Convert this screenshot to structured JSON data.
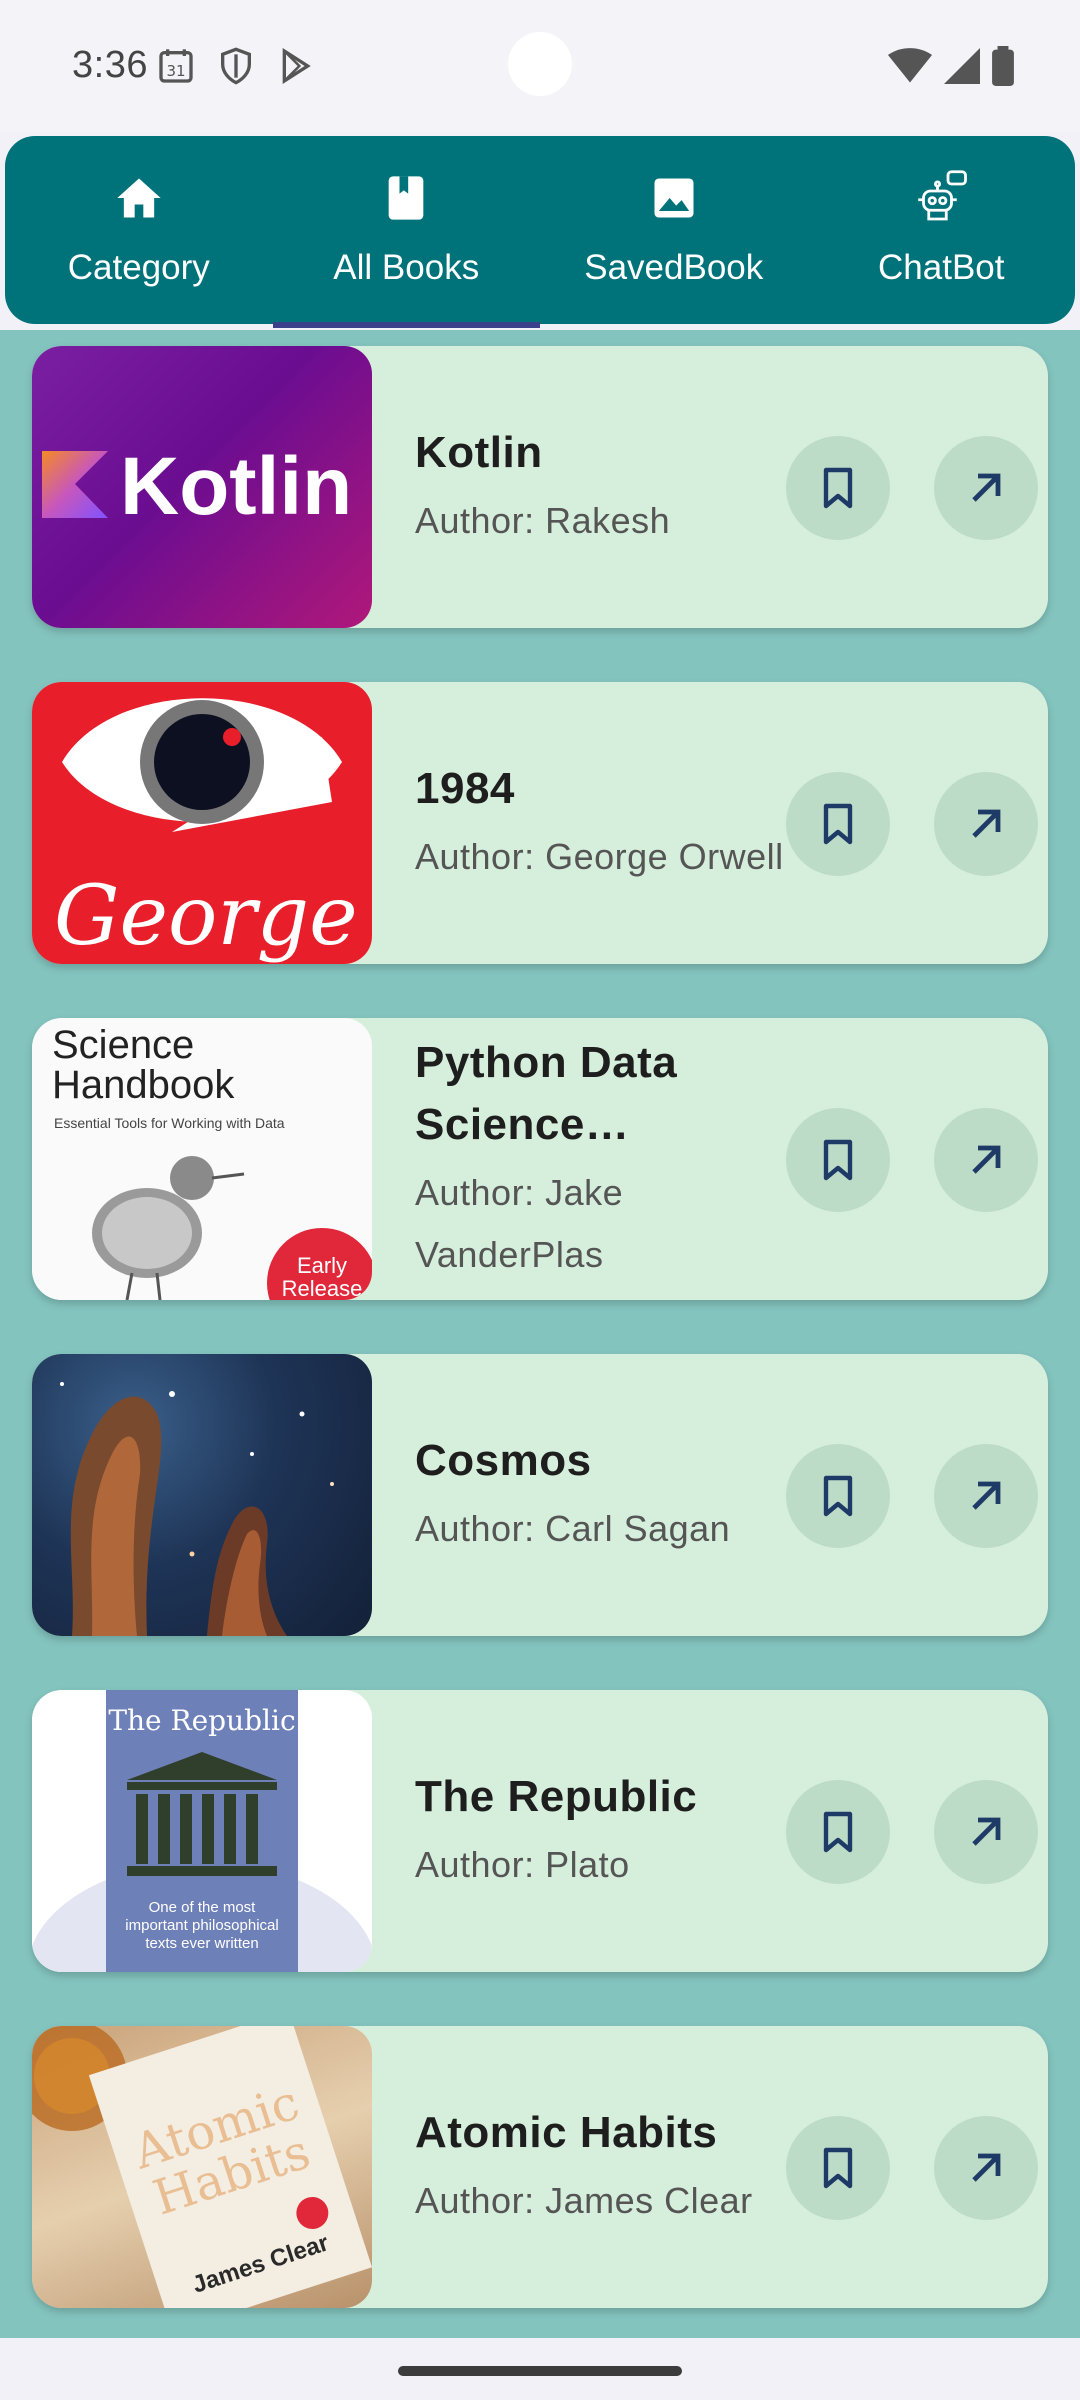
{
  "status_bar": {
    "time": "3:36",
    "left_icons": [
      "calendar-icon",
      "shield-icon",
      "play-store-icon"
    ],
    "right_icons": [
      "wifi-icon",
      "signal-icon",
      "battery-icon"
    ]
  },
  "nav": {
    "tabs": [
      {
        "label": "Category",
        "icon": "home-icon",
        "active": false
      },
      {
        "label": "All Books",
        "icon": "book-icon",
        "active": true
      },
      {
        "label": "SavedBook",
        "icon": "image-icon",
        "active": false
      },
      {
        "label": "ChatBot",
        "icon": "robot-icon",
        "active": false
      }
    ],
    "colors": {
      "background": "#00727a",
      "indicator": "#3c3f8a"
    }
  },
  "books": [
    {
      "title": "Kotlin",
      "author": "Author: Rakesh",
      "cover_text": "Kotlin"
    },
    {
      "title": "1984",
      "author": "Author: George Orwell",
      "cover_text": "George"
    },
    {
      "title": "Python Data Science Handbook",
      "author": "Author: Jake VanderPlas",
      "cover_text": "Science Handbook",
      "cover_subtext": "Essential Tools for Working with Data",
      "cover_badge": "Early Release"
    },
    {
      "title": "Cosmos",
      "author": "Author: Carl Sagan",
      "cover_text": ""
    },
    {
      "title": "The Republic",
      "author": "Author: Plato",
      "cover_text": "The Republic",
      "cover_subtext": "One of the most important philosophical texts ever written"
    },
    {
      "title": "Atomic Habits",
      "author": "Author: James Clear",
      "cover_text": "Atomic Habits",
      "cover_subtext": "James Clear"
    }
  ],
  "colors": {
    "content_background": "#84c4bf",
    "card_background": "#d6efdc",
    "button_background": "#bddcc8",
    "button_icon": "#1e3a66"
  }
}
